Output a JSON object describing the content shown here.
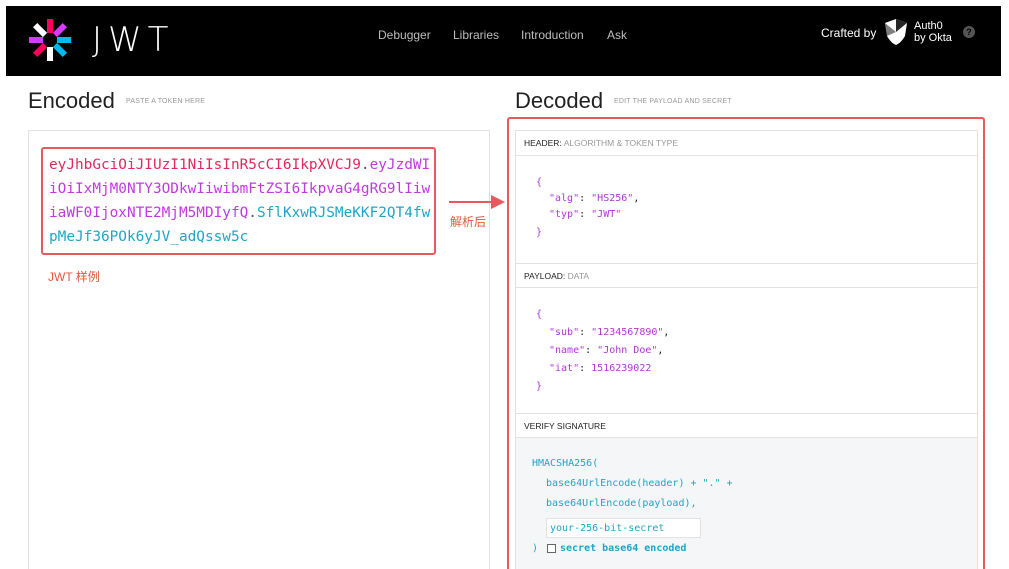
{
  "header": {
    "logo_text": "JWT",
    "nav": [
      "Debugger",
      "Libraries",
      "Introduction",
      "Ask"
    ],
    "crafted_by": "Crafted by",
    "auth0_line1": "Auth0",
    "auth0_line2": "by Okta",
    "help": "?"
  },
  "encoded": {
    "title": "Encoded",
    "subtitle": "PASTE A TOKEN HERE",
    "token_header": "eyJhbGciOiJIUzI1NiIsInR5cCI6IkpXVCJ9",
    "token_payload": "eyJzdWIiOiIxMjM0NTY3ODkwIiwibmFtZSI6IkpvaG4gRG9lIiwiaWF0IjoxNTE2MjM5MDIyfQ",
    "token_signature": "SflKxwRJSMeKKF2QT4fwpMeJf36POk6yJV_adQssw5c",
    "dot": ".",
    "caption": "JWT 样例"
  },
  "annotation": {
    "arrow_label": "解析后"
  },
  "decoded": {
    "title": "Decoded",
    "subtitle": "EDIT THE PAYLOAD AND SECRET",
    "header_section": {
      "label": "HEADER:",
      "sub": "ALGORITHM & TOKEN TYPE"
    },
    "header_json": {
      "open": "{",
      "alg_key": "\"alg\"",
      "alg_val": "\"HS256\"",
      "typ_key": "\"typ\"",
      "typ_val": "\"JWT\"",
      "close": "}"
    },
    "payload_section": {
      "label": "PAYLOAD:",
      "sub": "DATA"
    },
    "payload_json": {
      "open": "{",
      "sub_key": "\"sub\"",
      "sub_val": "\"1234567890\"",
      "name_key": "\"name\"",
      "name_val": "\"John Doe\"",
      "iat_key": "\"iat\"",
      "iat_val": "1516239022",
      "close": "}"
    },
    "verify_section": {
      "label": "VERIFY SIGNATURE"
    },
    "verify": {
      "line1": "HMACSHA256(",
      "line2": "base64UrlEncode(header) + \".\" +",
      "line3": "base64UrlEncode(payload),",
      "secret_placeholder": "your-256-bit-secret",
      "close": ")",
      "checkbox_label": "secret base64 encoded"
    }
  },
  "colors": {
    "header_part": "#e0295e",
    "payload_part": "#c03ae0",
    "signature_part": "#1fa5c7",
    "annotation_red": "#e8585c"
  }
}
